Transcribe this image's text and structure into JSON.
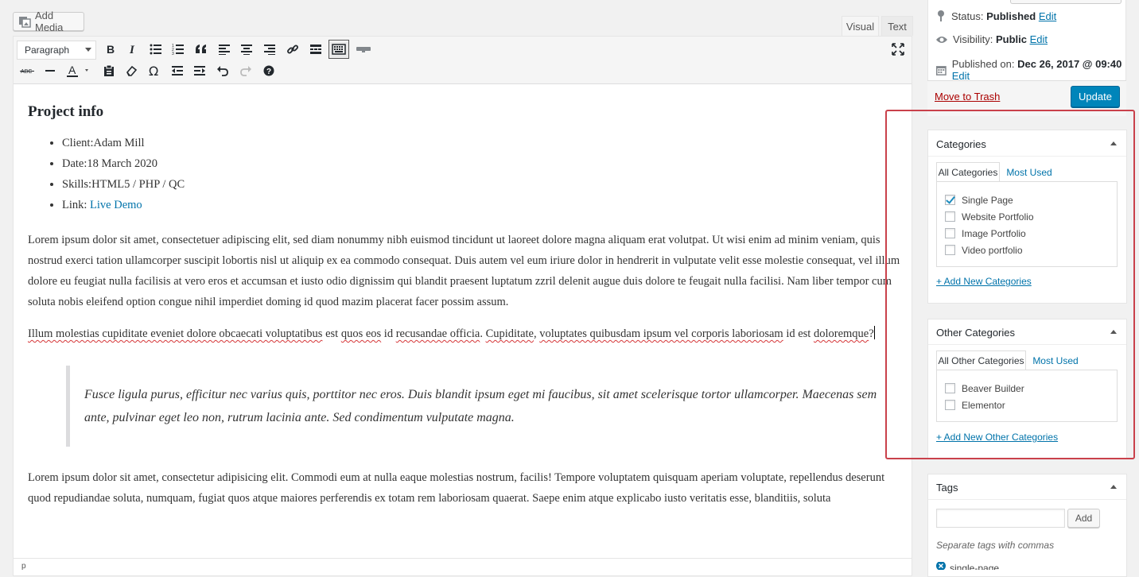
{
  "editor": {
    "add_media": "Add Media",
    "tabs": {
      "visual": "Visual",
      "text": "Text"
    },
    "format_select": "Paragraph",
    "status_path": "p"
  },
  "content": {
    "heading": "Project info",
    "list": [
      "Client:Adam Mill",
      "Date:18 March 2020",
      "Skills:HTML5 / PHP / QC"
    ],
    "link_label": "Link: ",
    "link_text": "Live Demo",
    "para1": "Lorem ipsum dolor sit amet, consectetuer adipiscing elit, sed diam nonummy nibh euismod tincidunt ut laoreet dolore magna aliquam erat volutpat. Ut wisi enim ad minim veniam, quis nostrud exerci tation ullamcorper suscipit lobortis nisl ut aliquip ex ea commodo consequat. Duis autem vel eum iriure dolor in hendrerit in vulputate velit esse molestie consequat, vel illum dolore eu feugiat nulla facilisis at vero eros et accumsan et iusto odio dignissim qui blandit praesent luptatum zzril delenit augue duis dolore te feugait nulla facilisi. Nam liber tempor cum soluta nobis eleifend option congue nihil imperdiet doming id quod mazim placerat facer possim assum.",
    "para2_parts": {
      "a": "Illum molestias cupiditate eveniet dolore obcaecati voluptatibus",
      "b": " est ",
      "c": "quos eos",
      "d": " id ",
      "e": "recusandae officia",
      "f": ". ",
      "g": "Cupiditate",
      "h": ", ",
      "i": "voluptates quibusdam ipsum vel corporis laboriosam",
      "j": " id est ",
      "k": "doloremque",
      "l": "?"
    },
    "quote": "Fusce ligula purus, efficitur nec varius quis, porttitor nec eros. Duis blandit ipsum eget mi faucibus, sit amet scelerisque tortor ullamcorper. Maecenas sem ante, pulvinar eget leo non, rutrum lacinia ante. Sed condimentum vulputate magna.",
    "para3": "Lorem ipsum dolor sit amet, consectetur adipisicing elit. Commodi eum at nulla eaque molestias nostrum, facilis! Tempore voluptatem quisquam aperiam voluptate, repellendus deserunt quod repudiandae soluta, numquam, fugiat quos atque maiores perferendis ex totam rem laboriosam quaerat. Saepe enim atque explicabo iusto veritatis esse, blanditiis, soluta"
  },
  "publish": {
    "status_label": "Status: ",
    "status_value": "Published",
    "visibility_label": "Visibility: ",
    "visibility_value": "Public",
    "published_label": "Published on: ",
    "published_value": "Dec 26, 2017 @ 09:40",
    "edit": "Edit",
    "trash": "Move to Trash",
    "update": "Update"
  },
  "categories": {
    "title": "Categories",
    "tab_all": "All Categories",
    "tab_most": "Most Used",
    "items": [
      {
        "label": "Single Page",
        "checked": true
      },
      {
        "label": "Website Portfolio",
        "checked": false
      },
      {
        "label": "Image Portfolio",
        "checked": false
      },
      {
        "label": "Video portfolio",
        "checked": false
      }
    ],
    "add_new": "+ Add New Categories"
  },
  "other_categories": {
    "title": "Other Categories",
    "tab_all": "All Other Categories",
    "tab_most": "Most Used",
    "items": [
      {
        "label": "Beaver Builder",
        "checked": false
      },
      {
        "label": "Elementor",
        "checked": false
      }
    ],
    "add_new": "+ Add New Other Categories"
  },
  "tags": {
    "title": "Tags",
    "add": "Add",
    "hint": "Separate tags with commas",
    "tag": "single-page"
  },
  "colors": {
    "accent": "#0085ba",
    "highlight": "#c9414b",
    "link": "#0073aa"
  }
}
